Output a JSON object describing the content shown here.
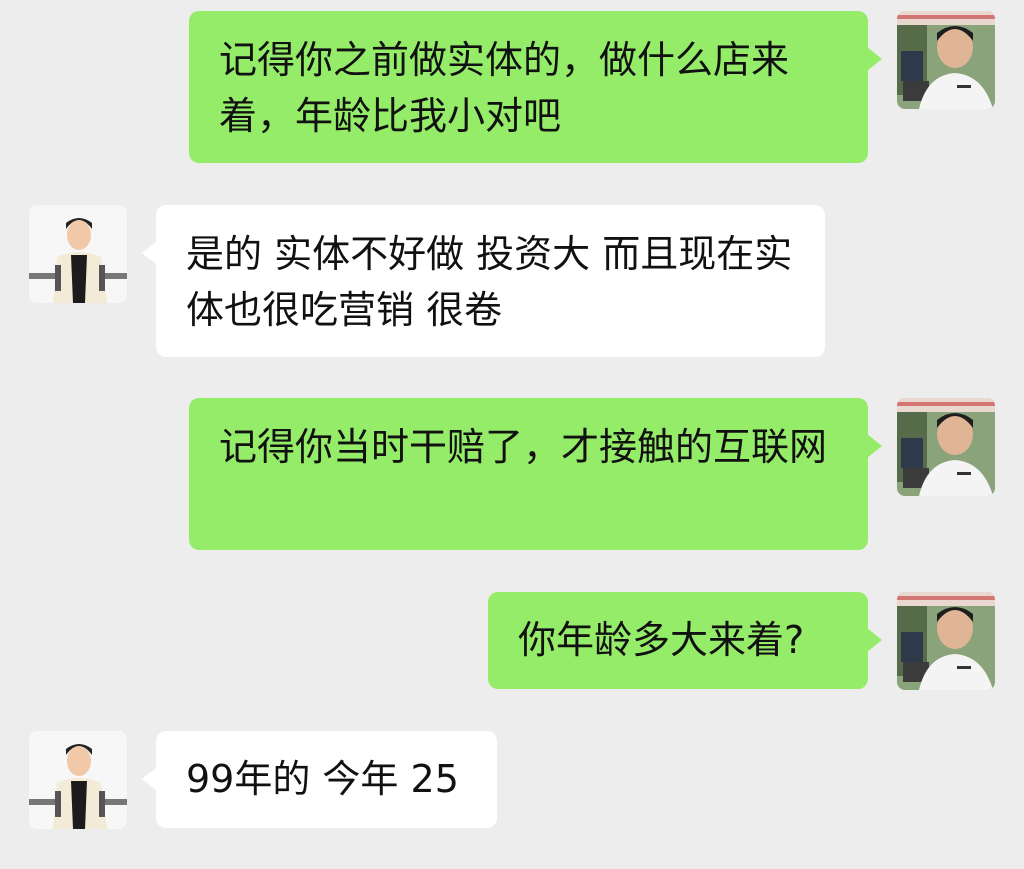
{
  "conversation": {
    "messages": [
      {
        "sender": "self",
        "avatar": "self-avatar-photo",
        "text": "记得你之前做实体的，做什么店来着，年龄比我小对吧"
      },
      {
        "sender": "other",
        "avatar": "other-avatar-cartoon",
        "text": "是的 实体不好做 投资大 而且现在实体也很吃营销 很卷"
      },
      {
        "sender": "self",
        "avatar": "self-avatar-photo",
        "text": "记得你当时干赔了，才接触的互联网"
      },
      {
        "sender": "self",
        "avatar": "self-avatar-photo",
        "text": "你年龄多大来着?"
      },
      {
        "sender": "other",
        "avatar": "other-avatar-cartoon",
        "text": "99年的 今年 25"
      }
    ]
  },
  "colors": {
    "background": "#ededed",
    "self_bubble": "#95ec69",
    "other_bubble": "#ffffff",
    "text": "#111111"
  }
}
